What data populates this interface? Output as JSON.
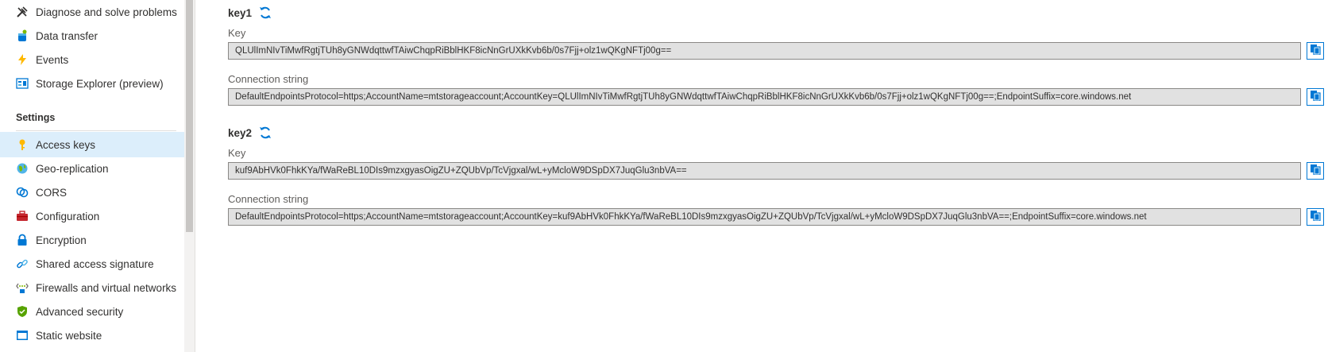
{
  "sidebar": {
    "items": [
      {
        "label": "Diagnose and solve problems",
        "icon": "wrench-icon"
      },
      {
        "label": "Data transfer",
        "icon": "data-transfer-icon"
      },
      {
        "label": "Events",
        "icon": "lightning-icon"
      },
      {
        "label": "Storage Explorer (preview)",
        "icon": "storage-explorer-icon"
      }
    ],
    "section_settings": "Settings",
    "settings_items": [
      {
        "label": "Access keys",
        "icon": "key-icon",
        "active": true
      },
      {
        "label": "Geo-replication",
        "icon": "globe-icon"
      },
      {
        "label": "CORS",
        "icon": "cors-icon"
      },
      {
        "label": "Configuration",
        "icon": "toolbox-icon"
      },
      {
        "label": "Encryption",
        "icon": "lock-icon"
      },
      {
        "label": "Shared access signature",
        "icon": "link-icon"
      },
      {
        "label": "Firewalls and virtual networks",
        "icon": "network-icon"
      },
      {
        "label": "Advanced security",
        "icon": "shield-icon"
      },
      {
        "label": "Static website",
        "icon": "website-icon"
      }
    ]
  },
  "keys": [
    {
      "title": "key1",
      "key_label": "Key",
      "key_value": "QLUlImNIvTiMwfRgtjTUh8yGNWdqttwfTAiwChqpRiBblHKF8icNnGrUXkKvb6b/0s7Fjj+olz1wQKgNFTj00g==",
      "conn_label": "Connection string",
      "conn_value": "DefaultEndpointsProtocol=https;AccountName=mtstorageaccount;AccountKey=QLUlImNIvTiMwfRgtjTUh8yGNWdqttwfTAiwChqpRiBblHKF8icNnGrUXkKvb6b/0s7Fjj+olz1wQKgNFTj00g==;EndpointSuffix=core.windows.net"
    },
    {
      "title": "key2",
      "key_label": "Key",
      "key_value": "kuf9AbHVk0FhkKYa/fWaReBL10DIs9mzxgyasOigZU+ZQUbVp/TcVjgxal/wL+yMcloW9DSpDX7JuqGlu3nbVA==",
      "conn_label": "Connection string",
      "conn_value": "DefaultEndpointsProtocol=https;AccountName=mtstorageaccount;AccountKey=kuf9AbHVk0FhkKYa/fWaReBL10DIs9mzxgyasOigZU+ZQUbVp/TcVjgxal/wL+yMcloW9DSpDX7JuqGlu3nbVA==;EndpointSuffix=core.windows.net"
    }
  ],
  "colors": {
    "accent": "#0078d4",
    "active_bg": "#dceefb",
    "field_bg": "#e1e1e1"
  }
}
